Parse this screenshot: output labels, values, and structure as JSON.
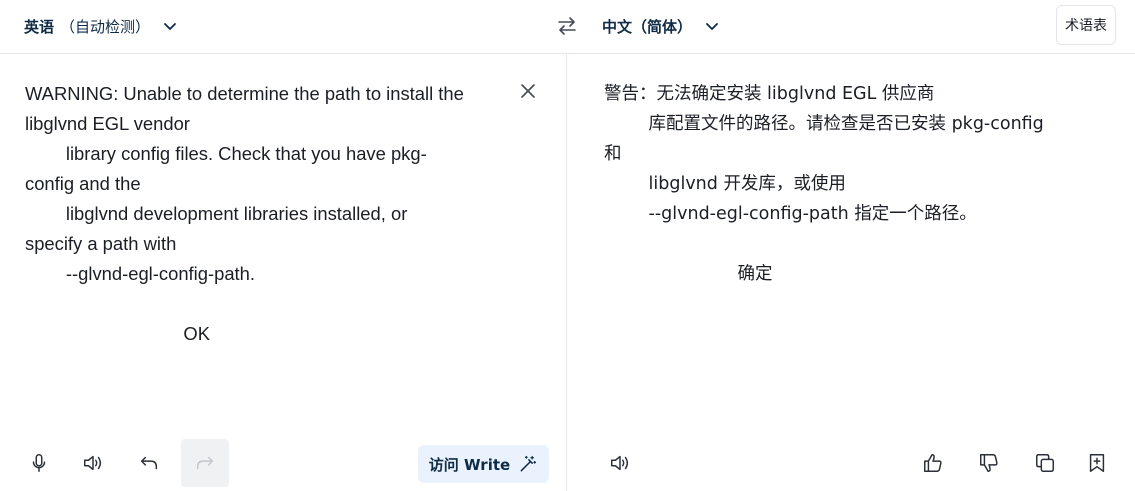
{
  "header": {
    "source_language": "英语",
    "source_language_detect": "（自动检测）",
    "target_language": "中文（简体）",
    "glossary_label": "术语表"
  },
  "source": {
    "text": "WARNING: Unable to determine the path to install the\nlibglvnd EGL vendor\n        library config files. Check that you have pkg-\nconfig and the\n        libglvnd development libraries installed, or\nspecify a path with\n        --glvnd-egl-config-path.\n\n                               OK"
  },
  "target": {
    "text": "警告：无法确定安装 libglvnd EGL 供应商\n        库配置文件的路径。请检查是否已安装 pkg-config\n和\n        libglvnd 开发库，或使用\n        --glvnd-egl-config-path 指定一个路径。\n\n                        确定"
  },
  "toolbar": {
    "write_label": "访问 Write"
  },
  "icons": {
    "clear": "close-icon",
    "mic": "microphone-icon",
    "speak": "speaker-icon",
    "undo": "undo-icon",
    "redo": "redo-icon",
    "swap": "swap-icon",
    "write": "magic-wand-icon",
    "like": "thumbs-up-icon",
    "dislike": "thumbs-down-icon",
    "copy": "copy-icon",
    "save": "bookmark-add-icon"
  }
}
